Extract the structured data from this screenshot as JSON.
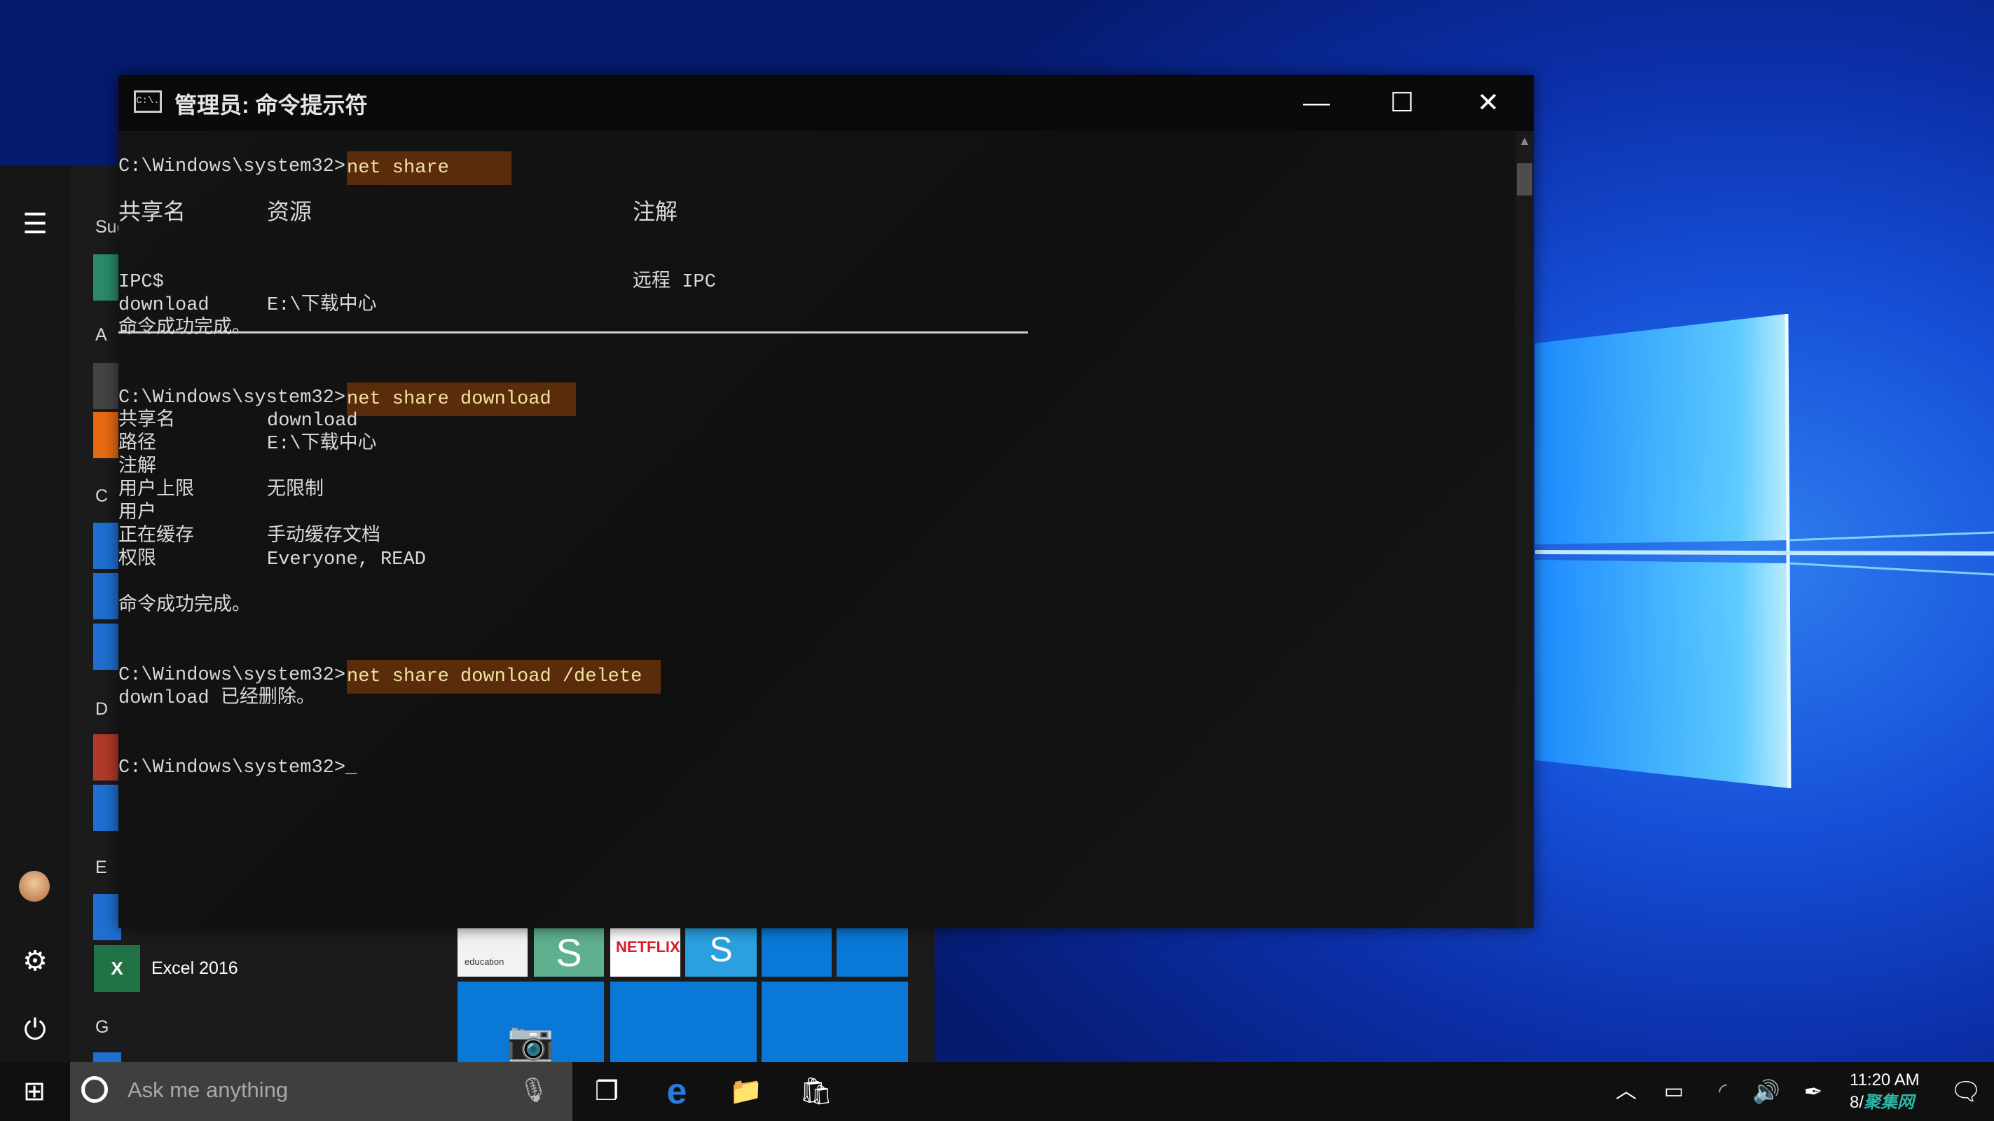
{
  "desktop": {
    "accent": "#1a6fe8"
  },
  "start_menu": {
    "section_suggested": "Sug",
    "letters": [
      "A",
      "C",
      "D",
      "E",
      "G"
    ],
    "apps": [
      {
        "label": "Excel 2016",
        "icon": "excel-icon"
      }
    ],
    "tiles": {
      "lego_label": "education",
      "netflix_label": "NETFLIX"
    }
  },
  "cmd": {
    "title": "管理员: 命令提示符",
    "icon_label": "C:\\.",
    "prompt": "C:\\Windows\\system32>",
    "cmd1": "net share",
    "hdr": {
      "name": "共享名",
      "resource": "资源",
      "remark": "注解"
    },
    "rows": [
      {
        "name": "IPC$",
        "resource": "",
        "remark": "远程 IPC"
      },
      {
        "name": "download",
        "resource": "E:\\下载中心",
        "remark": ""
      }
    ],
    "success": "命令成功完成。",
    "cmd2": "net share download",
    "details": [
      {
        "k": "共享名",
        "v": "download"
      },
      {
        "k": "路径",
        "v": "E:\\下载中心"
      },
      {
        "k": "注解",
        "v": ""
      },
      {
        "k": "用户上限",
        "v": "无限制"
      },
      {
        "k": "用户",
        "v": ""
      },
      {
        "k": "正在缓存",
        "v": "手动缓存文档"
      },
      {
        "k": "权限",
        "v": "Everyone, READ"
      }
    ],
    "cmd3": "net share download /delete",
    "deleted": "download 已经删除。",
    "cursor": "_",
    "highlight_color": "#5b2c0c"
  },
  "taskbar": {
    "search_placeholder": "Ask me anything",
    "time": "11:20 AM",
    "date": "8/",
    "watermark": "聚集网"
  }
}
